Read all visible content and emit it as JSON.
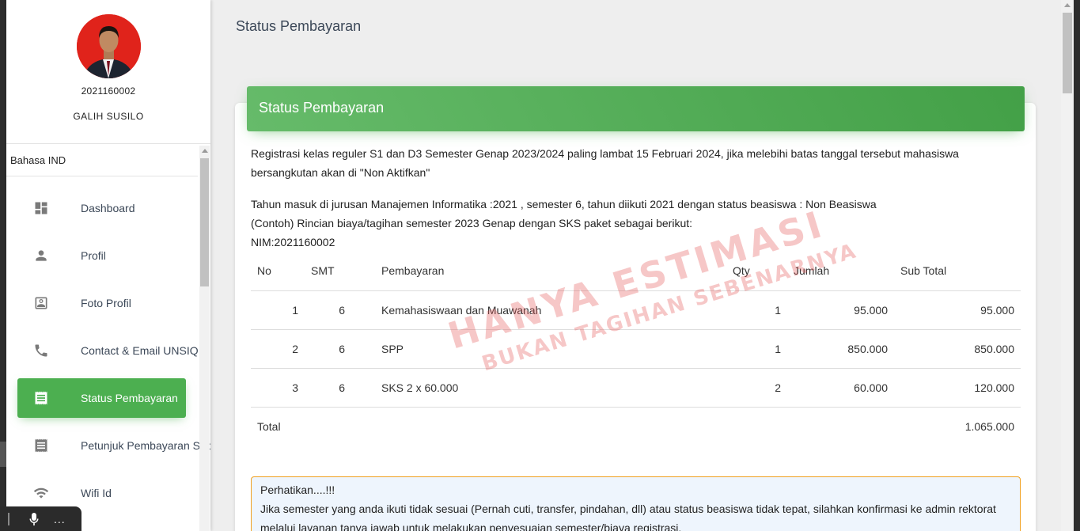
{
  "profile": {
    "nim": "2021160002",
    "name": "GALIH SUSILO"
  },
  "language": "Bahasa IND",
  "menu": [
    {
      "label": "Dashboard",
      "icon": "dashboard-icon",
      "active": false
    },
    {
      "label": "Profil",
      "icon": "person-icon",
      "active": false
    },
    {
      "label": "Foto Profil",
      "icon": "photo-profile-icon",
      "active": false
    },
    {
      "label": "Contact & Email UNSIQ",
      "icon": "phone-icon",
      "active": false
    },
    {
      "label": "Status Pembayaran",
      "icon": "receipt-icon",
      "active": true
    },
    {
      "label": "Petunjuk Pembayaran Shopee",
      "icon": "receipt-icon",
      "active": false
    },
    {
      "label": "Wifi Id",
      "icon": "wifi-icon",
      "active": false
    }
  ],
  "page_title": "Status Pembayaran",
  "card": {
    "title": "Status Pembayaran",
    "paragraph1_line1": "Registrasi kelas reguler S1 dan D3 Semester Genap 2023/2024 paling lambat 15 Februari 2024, jika melebihi batas tanggal tersebut mahasiswa",
    "paragraph1_line2": "bersangkutan akan di \"Non Aktifkan\"",
    "info_line1": "Tahun masuk di jurusan Manajemen Informatika :2021 , semester 6, tahun diikuti 2021 dengan status beasiswa : Non Beasiswa",
    "info_line2": "(Contoh) Rincian biaya/tagihan semester 2023 Genap dengan SKS paket sebagai berikut:",
    "info_line3": "NIM:2021160002"
  },
  "table": {
    "headers": {
      "no": "No",
      "smt": "SMT",
      "pembayaran": "Pembayaran",
      "qty": "Qty",
      "jumlah": "Jumlah",
      "subtotal": "Sub Total"
    },
    "rows": [
      {
        "no": "1",
        "smt": "6",
        "pembayaran": "Kemahasiswaan dan Muawanah",
        "qty": "1",
        "jumlah": "95.000",
        "subtotal": "95.000"
      },
      {
        "no": "2",
        "smt": "6",
        "pembayaran": "SPP",
        "qty": "1",
        "jumlah": "850.000",
        "subtotal": "850.000"
      },
      {
        "no": "3",
        "smt": "6",
        "pembayaran": "SKS 2 x 60.000",
        "qty": "2",
        "jumlah": "60.000",
        "subtotal": "120.000"
      }
    ],
    "total_label": "Total",
    "total_value": "1.065.000"
  },
  "watermark": {
    "line1": "HANYA ESTIMASI",
    "line2": "BUKAN TAGIHAN SEBENARNYA"
  },
  "notice": {
    "title": "Perhatikan....!!!",
    "line1": "Jika semester yang anda ikuti tidak sesuai (Pernah cuti, transfer, pindahan, dll) atau status beasiswa tidak tepat, silahkan konfirmasi ke admin rektorat",
    "line2": "melalui layanan tanya jawab untuk melakukan penyesuaian semester/biaya registrasi."
  },
  "voice_bar": {
    "more": "..."
  },
  "colors": {
    "accent": "#4caf50",
    "avatar_bg": "#e0231b",
    "watermark": "#e45050",
    "notice_border": "#f0a020",
    "notice_bg": "#eef5fd"
  }
}
